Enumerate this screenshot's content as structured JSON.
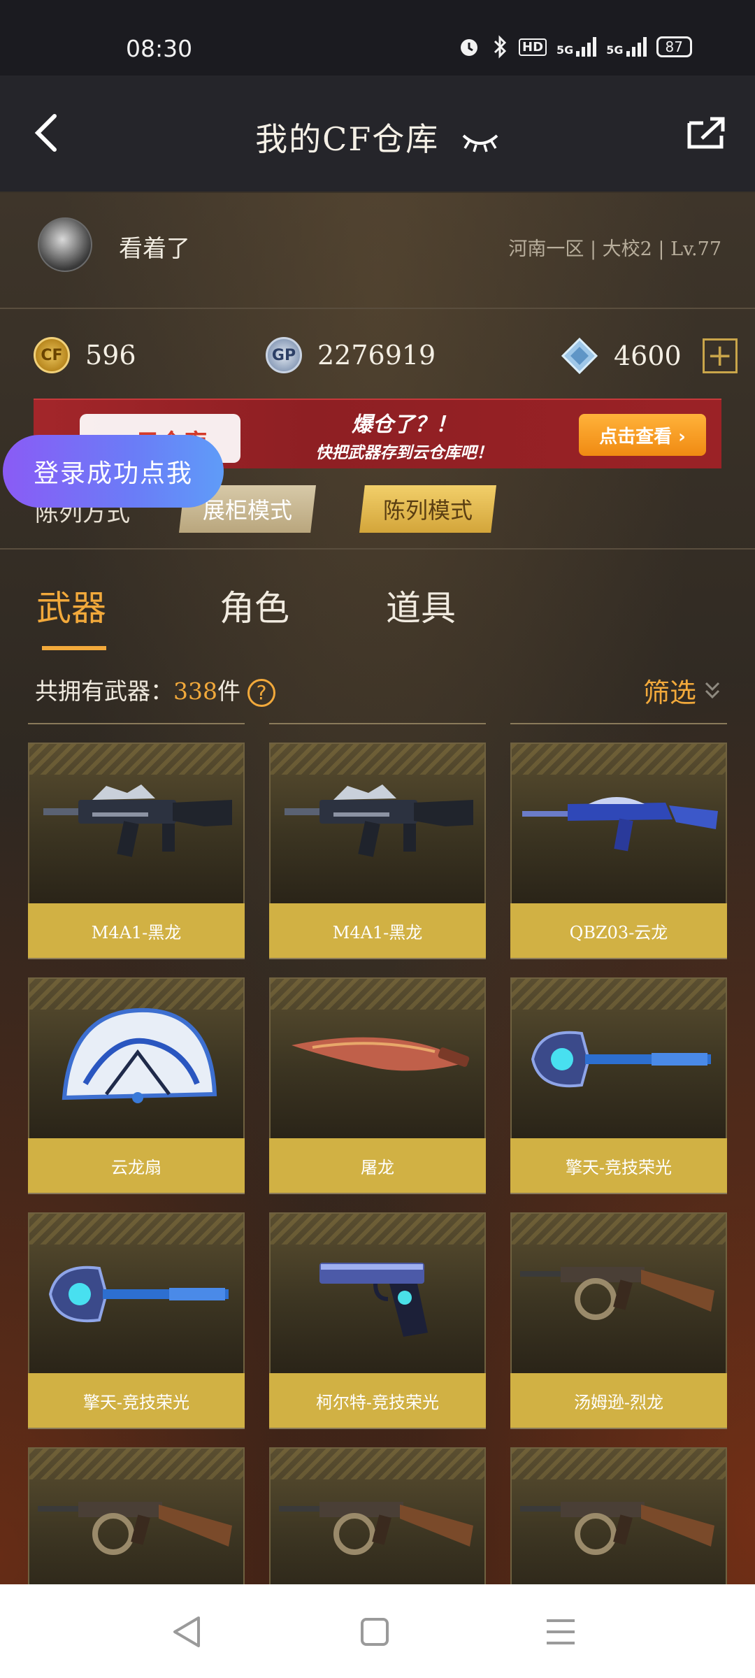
{
  "status_bar": {
    "time": "08:30",
    "hd_label": "HD",
    "net1": "5G",
    "net2": "5G",
    "battery": "87"
  },
  "header": {
    "title": "我的CF仓库"
  },
  "profile": {
    "nickname": "看着了",
    "server_info": "河南一区 | 大校2 | Lv.77"
  },
  "currency": {
    "cf_icon_text": "CF",
    "cf_points": "596",
    "gp_icon_text": "GP",
    "gp": "2276919",
    "diamonds": "4600",
    "add_label": "+"
  },
  "banner": {
    "left_text": "云仓库",
    "line1": "爆仓了？！",
    "line2": "快把武器存到云仓库吧！",
    "button": "点击查看 ›"
  },
  "display_mode": {
    "label": "陈列方式",
    "cabinet": "展柜模式",
    "list": "陈列模式"
  },
  "toast": {
    "text": "登录成功点我"
  },
  "tabs": {
    "weapons": "武器",
    "roles": "角色",
    "items": "道具"
  },
  "inventory": {
    "count_prefix": "共拥有武器：",
    "count": "338",
    "count_suffix": "件",
    "help_icon": "?",
    "filter": "筛选"
  },
  "cards": [
    {
      "name": "M4A1-黑龙",
      "icon": "rifle-icon"
    },
    {
      "name": "M4A1-黑龙",
      "icon": "rifle-icon"
    },
    {
      "name": "QBZ03-云龙",
      "icon": "rifle-icon"
    },
    {
      "name": "云龙扇",
      "icon": "fan-icon"
    },
    {
      "name": "屠龙",
      "icon": "knife-icon"
    },
    {
      "name": "擎天-竞技荣光",
      "icon": "shovel-icon"
    },
    {
      "name": "擎天-竞技荣光",
      "icon": "shovel-icon"
    },
    {
      "name": "柯尔特-竞技荣光",
      "icon": "pistol-icon"
    },
    {
      "name": "汤姆逊-烈龙",
      "icon": "smg-icon"
    },
    {
      "name": "",
      "icon": "smg-icon"
    },
    {
      "name": "",
      "icon": "smg-icon"
    },
    {
      "name": "",
      "icon": "smg-icon"
    }
  ],
  "colors": {
    "accent": "#f2a93b",
    "card_label": "#d1b144",
    "banner_red": "#a3262a"
  }
}
